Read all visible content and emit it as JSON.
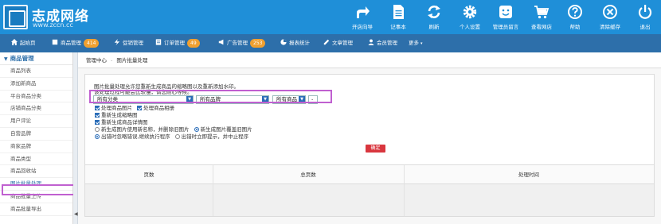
{
  "brand": {
    "name": "志成网络",
    "url": "www.zccn.cc"
  },
  "topbar": {
    "buttons": [
      {
        "label": "开店向导",
        "icon": "share-arrow-icon"
      },
      {
        "label": "记事本",
        "icon": "notepad-icon"
      },
      {
        "label": "刷新",
        "icon": "refresh-icon"
      },
      {
        "label": "个人设置",
        "icon": "gear-icon"
      },
      {
        "label": "管理员留言",
        "icon": "smiley-icon"
      },
      {
        "label": "查看网店",
        "icon": "cart-icon"
      },
      {
        "label": "帮助",
        "icon": "help-icon"
      },
      {
        "label": "清除缓存",
        "icon": "close-circle-icon"
      },
      {
        "label": "退出",
        "icon": "power-icon"
      }
    ]
  },
  "nav": {
    "items": [
      {
        "label": "起始页",
        "badge": ""
      },
      {
        "label": "商品管理",
        "badge": "414"
      },
      {
        "label": "促销管理",
        "badge": ""
      },
      {
        "label": "订单管理",
        "badge": "49"
      },
      {
        "label": "广告管理",
        "badge": "253"
      },
      {
        "label": "报表统计",
        "badge": ""
      },
      {
        "label": "文章管理",
        "badge": ""
      },
      {
        "label": "会员管理",
        "badge": ""
      },
      {
        "label": "更多",
        "badge": ""
      }
    ]
  },
  "sidebar": {
    "heading": "商品管理",
    "items": [
      {
        "label": "商品列表"
      },
      {
        "label": "添加新商品"
      },
      {
        "label": "平台商品分类"
      },
      {
        "label": "店铺商品分类"
      },
      {
        "label": "用户评论"
      },
      {
        "label": "自营品牌"
      },
      {
        "label": "商家品牌"
      },
      {
        "label": "商品类型"
      },
      {
        "label": "商品回收站"
      },
      {
        "label": "图片批量处理"
      },
      {
        "label": "商品批量上传"
      },
      {
        "label": "商品批量导出"
      }
    ],
    "active_index": 9
  },
  "breadcrumb": {
    "root": "管理中心",
    "separator": "-",
    "current": "图片批量处理"
  },
  "main": {
    "intro_line1": "图片批量处理允许您重新生成商品的缩略图以及重新添加水印。",
    "intro_line2": "该处理过程可能会比较慢，请您耐心等候。",
    "filters": {
      "category": "所有分类",
      "brand": "所有品牌",
      "goods": "所有商品",
      "extra": "-"
    },
    "checkboxes": [
      {
        "label": "处理商品图片",
        "checked": true
      },
      {
        "label": "处理商品相册",
        "checked": true
      },
      {
        "label": "重新生成缩略图",
        "checked": true
      },
      {
        "label": "重新生成商品详情图",
        "checked": true
      }
    ],
    "radio_groups": [
      [
        {
          "label": "新生成图片使用新名称，并删除旧图片",
          "checked": false
        },
        {
          "label": "新生成图片覆盖旧图片",
          "checked": true
        }
      ],
      [
        {
          "label": "出错时忽略错误,继续执行程序",
          "checked": true
        },
        {
          "label": "出错时立即提示，并中止程序",
          "checked": false
        }
      ]
    ],
    "confirm_label": "确定"
  },
  "table": {
    "columns": [
      "页数",
      "总页数",
      "处理时间"
    ]
  },
  "colors": {
    "topbar": "#1f8fd8",
    "navbar": "#2d6faa",
    "badge": "#f0a030",
    "confirm": "#d9363e",
    "highlight": "#c060d0"
  }
}
